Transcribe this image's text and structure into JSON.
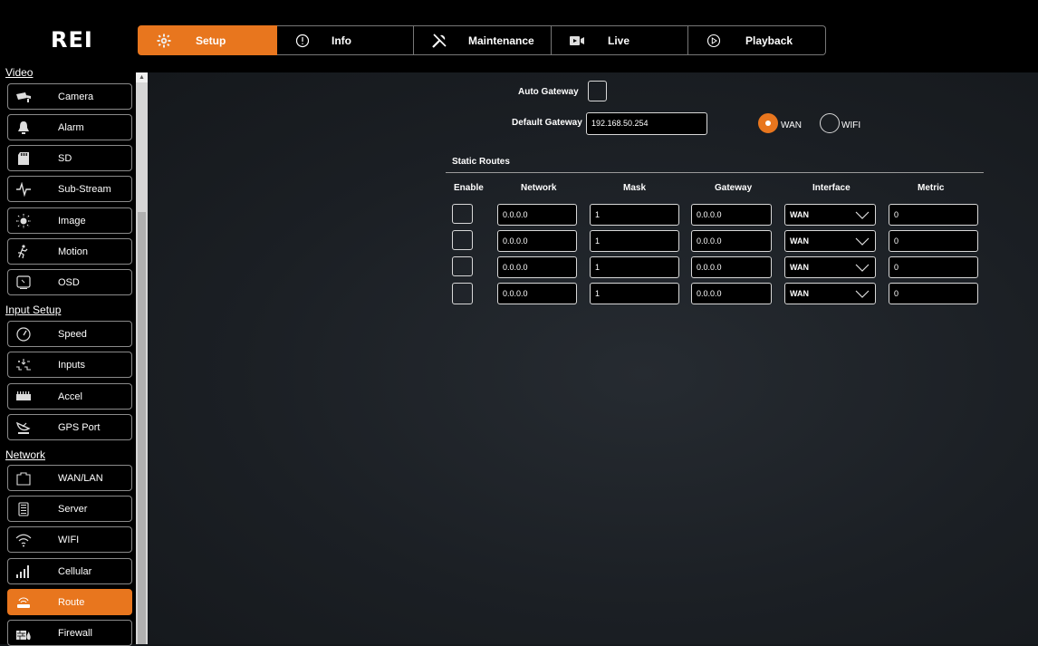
{
  "brand": {
    "logo": "REI"
  },
  "tabs": [
    {
      "label": "Setup",
      "icon": "setup-gear-icon",
      "active": true
    },
    {
      "label": "Info",
      "icon": "info-icon",
      "active": false
    },
    {
      "label": "Maintenance",
      "icon": "tools-icon",
      "active": false
    },
    {
      "label": "Live",
      "icon": "live-camera-icon",
      "active": false
    },
    {
      "label": "Playback",
      "icon": "play-icon",
      "active": false
    }
  ],
  "sidebar": {
    "sections": [
      {
        "title": "Video",
        "items": [
          {
            "label": "Camera",
            "icon": "camera-icon"
          },
          {
            "label": "Alarm",
            "icon": "bell-icon"
          },
          {
            "label": "SD",
            "icon": "sd-card-icon"
          },
          {
            "label": "Sub-Stream",
            "icon": "waveform-icon"
          },
          {
            "label": "Image",
            "icon": "brightness-icon"
          },
          {
            "label": "Motion",
            "icon": "running-person-icon"
          },
          {
            "label": "OSD",
            "icon": "osd-icon"
          }
        ]
      },
      {
        "title": "Input Setup",
        "items": [
          {
            "label": "Speed",
            "icon": "speedometer-icon"
          },
          {
            "label": "Inputs",
            "icon": "inputs-icon"
          },
          {
            "label": "Accel",
            "icon": "accel-icon"
          },
          {
            "label": "GPS Port",
            "icon": "satellite-icon"
          }
        ]
      },
      {
        "title": "Network",
        "items": [
          {
            "label": "WAN/LAN",
            "icon": "network-port-icon"
          },
          {
            "label": "Server",
            "icon": "server-icon"
          },
          {
            "label": "WIFI",
            "icon": "wifi-icon"
          },
          {
            "label": "Cellular",
            "icon": "cellular-icon"
          },
          {
            "label": "Route",
            "icon": "router-icon",
            "active": true
          },
          {
            "label": "Firewall",
            "icon": "firewall-icon"
          }
        ]
      }
    ]
  },
  "gateway": {
    "auto_label": "Auto Gateway",
    "default_label": "Default Gateway",
    "default_value": "192.168.50.254",
    "options": [
      {
        "label": "WAN",
        "selected": true
      },
      {
        "label": "WIFI",
        "selected": false
      }
    ]
  },
  "static_routes": {
    "title": "Static Routes",
    "columns": [
      "Enable",
      "Network",
      "Mask",
      "Gateway",
      "Interface",
      "Metric"
    ],
    "rows": [
      {
        "network": "0.0.0.0",
        "mask": "1",
        "gateway": "0.0.0.0",
        "interface": "WAN",
        "metric": "0"
      },
      {
        "network": "0.0.0.0",
        "mask": "1",
        "gateway": "0.0.0.0",
        "interface": "WAN",
        "metric": "0"
      },
      {
        "network": "0.0.0.0",
        "mask": "1",
        "gateway": "0.0.0.0",
        "interface": "WAN",
        "metric": "0"
      },
      {
        "network": "0.0.0.0",
        "mask": "1",
        "gateway": "0.0.0.0",
        "interface": "WAN",
        "metric": "0"
      }
    ]
  },
  "colors": {
    "accent": "#e8761e",
    "background": "#1b1f24",
    "bar": "#000000"
  }
}
